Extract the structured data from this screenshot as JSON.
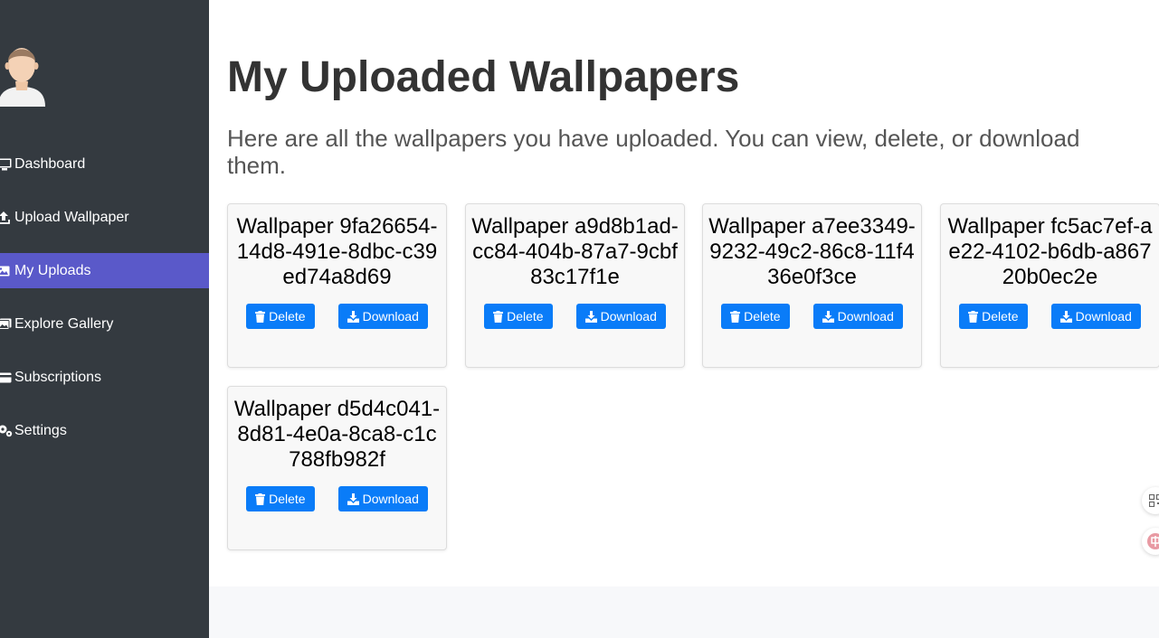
{
  "sidebar": {
    "avatar": "user-avatar",
    "items": [
      {
        "label": "Dashboard",
        "icon": "desktop-icon",
        "active": false
      },
      {
        "label": "Upload Wallpaper",
        "icon": "upload-icon",
        "active": false
      },
      {
        "label": "My Uploads",
        "icon": "image-icon",
        "active": true
      },
      {
        "label": "Explore Gallery",
        "icon": "images-icon",
        "active": false
      },
      {
        "label": "Subscriptions",
        "icon": "credit-card-icon",
        "active": false
      },
      {
        "label": "Settings",
        "icon": "gears-icon",
        "active": false
      }
    ],
    "active_color": "#5a59c9"
  },
  "main": {
    "title": "My Uploaded Wallpapers",
    "description": "Here are all the wallpapers you have uploaded. You can view, delete, or download them."
  },
  "wallpapers": [
    {
      "title": "Wallpaper 9fa26654-14d8-491e-8dbc-c39ed74a8d69",
      "delete_label": "Delete",
      "download_label": "Download"
    },
    {
      "title": "Wallpaper a9d8b1ad-cc84-404b-87a7-9cbf83c17f1e",
      "delete_label": "Delete",
      "download_label": "Download"
    },
    {
      "title": "Wallpaper a7ee3349-9232-49c2-86c8-11f436e0f3ce",
      "delete_label": "Delete",
      "download_label": "Download"
    },
    {
      "title": "Wallpaper fc5ac7ef-ae22-4102-b6db-a86720b0ec2e",
      "delete_label": "Delete",
      "download_label": "Download"
    },
    {
      "title": "Wallpaper d5d4c041-8d81-4e0a-8ca8-c1c788fb982f",
      "delete_label": "Delete",
      "download_label": "Download"
    }
  ],
  "colors": {
    "sidebar_bg": "#343a40",
    "button_blue": "#0a7cf8"
  },
  "floating_tools": [
    "qr-code-icon",
    "translate-icon"
  ]
}
